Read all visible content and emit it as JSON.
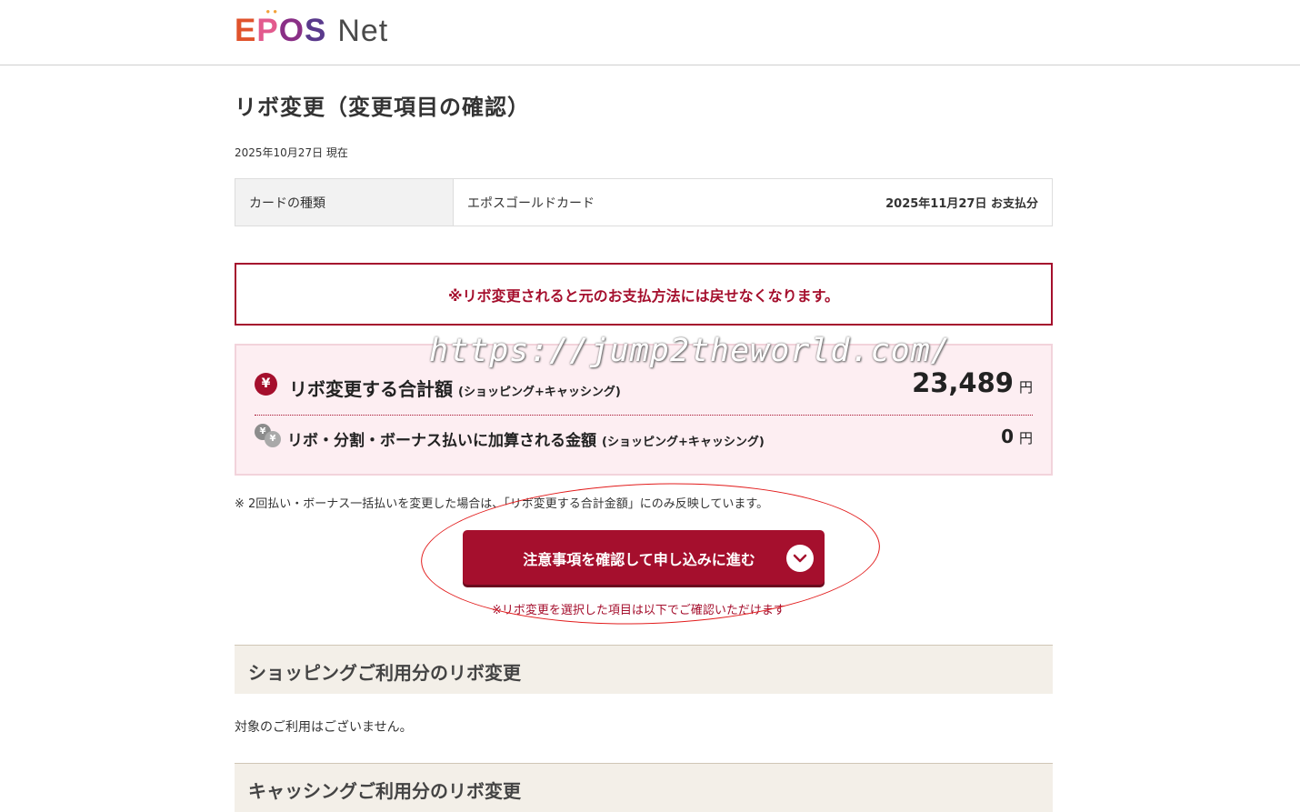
{
  "header": {
    "logo_letters": [
      "E",
      "P",
      "O",
      "S"
    ],
    "logo_net": "Net"
  },
  "page": {
    "title": "リボ変更（変更項目の確認）",
    "as_of": "2025年10月27日 現在"
  },
  "card_info": {
    "label": "カードの種類",
    "card_name": "エポスゴールドカード",
    "payment_date": "2025年11月27日 お支払分"
  },
  "warning": "※リボ変更されると元のお支払方法には戻せなくなります。",
  "summary": {
    "row1": {
      "icon": "yen-icon",
      "icon_glyph": "¥",
      "label": "リボ変更する合計額",
      "sub": "(ショッピング+キャッシング)",
      "amount": "23,489",
      "unit": "円"
    },
    "row2": {
      "icon": "coins-icon",
      "icon_glyph": "¥",
      "label": "リボ・分割・ボーナス払いに加算される金額",
      "sub": "(ショッピング+キャッシング)",
      "amount": "0",
      "unit": "円"
    }
  },
  "note": "※ 2回払い・ボーナス一括払いを変更した場合は、「リボ変更する合計金額」にのみ反映しています。",
  "watermark": "https://jump2theworld.com/",
  "cta": {
    "label": "注意事項を確認して申し込みに進む",
    "note": "※リボ変更を選択した項目は以下でご確認いただけます"
  },
  "sections": {
    "shopping": {
      "title": "ショッピングご利用分のリボ変更",
      "empty": "対象のご利用はございません。"
    },
    "cashing": {
      "title": "キャッシングご利用分のリボ変更"
    }
  },
  "colors": {
    "brand": "#a50f2d",
    "summary_bg": "#fdeef2",
    "section_bg": "#f3efe8",
    "annotation": "#e21c1c"
  }
}
